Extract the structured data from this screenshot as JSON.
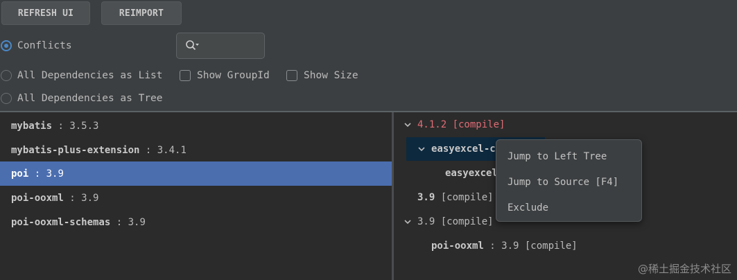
{
  "toolbar": {
    "refresh_label": "REFRESH UI",
    "reimport_label": "REIMPORT"
  },
  "options": {
    "conflicts_label": "Conflicts",
    "all_list_label": "All Dependencies as List",
    "all_tree_label": "All Dependencies as Tree",
    "show_groupid_label": "Show GroupId",
    "show_size_label": "Show Size",
    "selected_mode": "Conflicts",
    "show_groupid_checked": false,
    "show_size_checked": false
  },
  "search": {
    "value": "",
    "icon": "search-icon"
  },
  "left_list": [
    {
      "name": "mybatis",
      "version": "3.5.3"
    },
    {
      "name": "mybatis-plus-extension",
      "version": "3.4.1"
    },
    {
      "name": "poi",
      "version": "3.9",
      "selected": true
    },
    {
      "name": "poi-ooxml",
      "version": "3.9"
    },
    {
      "name": "poi-ooxml-schemas",
      "version": "3.9"
    }
  ],
  "tree": {
    "row1": {
      "text": "4.1.2 [compile]"
    },
    "row2": {
      "name": "easyexcel-c"
    },
    "row3": {
      "name": "easyexcel"
    },
    "row4": {
      "version": "3.9",
      "scope": "[compile]"
    },
    "row5": {
      "text": "3.9 [compile]"
    },
    "row6": {
      "name": "poi-ooxml",
      "version": "3.9 [compile]"
    }
  },
  "context_menu": {
    "items": [
      "Jump to Left Tree",
      "Jump to Source [F4]",
      "Exclude"
    ]
  },
  "watermark": "@稀土掘金技术社区",
  "colors": {
    "accent": "#4a88c7",
    "selection": "#4b6eaf",
    "conflict": "#e06c75"
  }
}
